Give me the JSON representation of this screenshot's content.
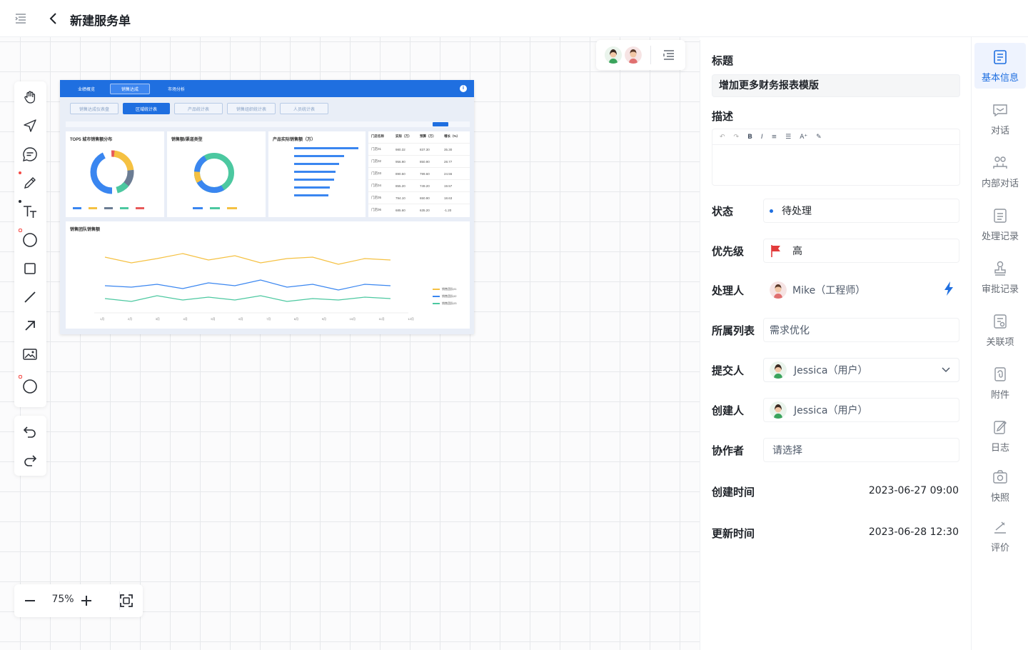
{
  "header": {
    "title": "新建服务单"
  },
  "zoom": {
    "value": "75%"
  },
  "dashboard": {
    "tabs": [
      "业绩概览",
      "销售达成",
      "市场分析"
    ],
    "sub_tabs": [
      "销售达成仪表盘",
      "区域统计表",
      "产品统计表",
      "销售组织统计表",
      "人员统计表"
    ],
    "card1_title": "TOP5 城市销售额分布",
    "card2_title": "销售额/渠道类型",
    "card3_title": "产品实际销售额（万）",
    "card4_title": "销售团队销售额",
    "table_headers": [
      "门店名称",
      "实际（万）",
      "预算（万）",
      "增长（%）"
    ],
    "table_rows": [
      [
        "门店01",
        "980.32",
        "837.30",
        "35.30"
      ],
      [
        "门店02",
        "956.90",
        "850.90",
        "28.77"
      ],
      [
        "门店03",
        "890.50",
        "799.60",
        "24.56"
      ],
      [
        "门店04",
        "855.20",
        "749.20",
        "19.57"
      ],
      [
        "门店05",
        "794.10",
        "650.90",
        "18.63"
      ],
      [
        "门店06",
        "685.60",
        "635.20",
        "-1.20"
      ]
    ],
    "legend_line": [
      "销售团队01",
      "销售团队02",
      "销售团队03"
    ],
    "months": [
      "1月",
      "2月",
      "3月",
      "4月",
      "5月",
      "6月",
      "7月",
      "8月",
      "9月",
      "10月",
      "11月",
      "12月"
    ]
  },
  "detail": {
    "title_label": "标题",
    "title_value": "增加更多财务报表模版",
    "desc_label": "描述",
    "status_label": "状态",
    "status_value": "待处理",
    "priority_label": "优先级",
    "priority_value": "高",
    "handler_label": "处理人",
    "handler_value": "Mike（工程师）",
    "list_label": "所属列表",
    "list_value": "需求优化",
    "submitter_label": "提交人",
    "submitter_value": "Jessica（用户）",
    "creator_label": "创建人",
    "creator_value": "Jessica（用户）",
    "collab_label": "协作者",
    "collab_placeholder": "请选择",
    "created_label": "创建时间",
    "created_value": "2023-06-27 09:00",
    "updated_label": "更新时间",
    "updated_value": "2023-06-28 12:30"
  },
  "side_tabs": [
    {
      "label": "基本信息",
      "icon": "info-card-icon"
    },
    {
      "label": "对话",
      "icon": "chat-icon"
    },
    {
      "label": "内部对话",
      "icon": "team-icon"
    },
    {
      "label": "处理记录",
      "icon": "record-icon"
    },
    {
      "label": "审批记录",
      "icon": "stamp-icon"
    },
    {
      "label": "关联项",
      "icon": "link-doc-icon"
    },
    {
      "label": "附件",
      "icon": "attachment-icon"
    },
    {
      "label": "日志",
      "icon": "log-icon"
    },
    {
      "label": "快照",
      "icon": "camera-icon"
    },
    {
      "label": "评价",
      "icon": "rate-icon"
    }
  ],
  "colors": {
    "accent": "#1f6fe0",
    "flag": "#e23b3b",
    "status_dot": "#1f6fe0"
  }
}
